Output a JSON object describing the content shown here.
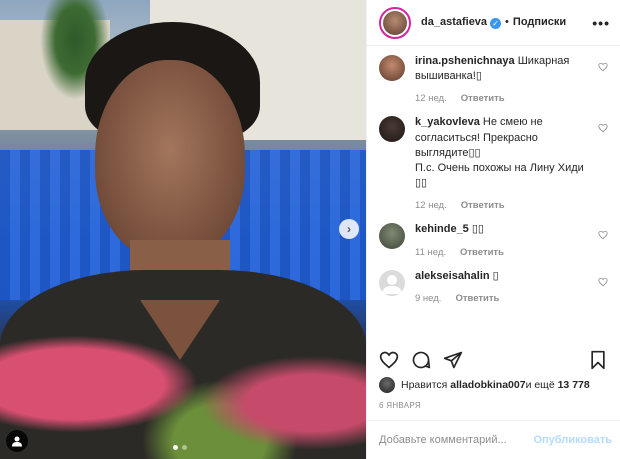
{
  "post": {
    "author": "da_astafieva",
    "follow_label": "Подписки",
    "separator": "•",
    "more": "•••",
    "photo_count": 2,
    "photo_index": 1
  },
  "comments": [
    {
      "user": "irina.pshenichnaya",
      "text": "Шикарная вышиванка!▯",
      "time": "12 нед.",
      "reply": "Ответить"
    },
    {
      "user": "k_yakovleva",
      "text": "Не смею не согласиться! Прекрасно выглядите▯▯\nП.с. Очень похожы на Лину Хиди ▯▯",
      "time": "12 нед.",
      "reply": "Ответить"
    },
    {
      "user": "kehinde_5",
      "text": "▯▯",
      "time": "11 нед.",
      "reply": "Ответить"
    },
    {
      "user": "alekseisahalin",
      "text": "▯",
      "time": "9 нед.",
      "reply": "Ответить"
    }
  ],
  "likes": {
    "prefix": "Нравится ",
    "user": "alladobkina007",
    "middle": " и ещё ",
    "count": "13 778"
  },
  "date": "6 ЯНВАРЯ",
  "add_comment": {
    "placeholder": "Добавьте комментарий...",
    "publish": "Опубликовать"
  },
  "icons": {
    "verified": "verified-badge",
    "like": "heart-icon",
    "comment": "comment-icon",
    "share": "paper-plane-icon",
    "save": "bookmark-icon",
    "next": "chevron-right-icon",
    "tagged": "user-icon"
  },
  "colors": {
    "verified": "#3897f0",
    "publish": "#b3dbff",
    "muted": "#8e8e8e",
    "text": "#262626"
  }
}
